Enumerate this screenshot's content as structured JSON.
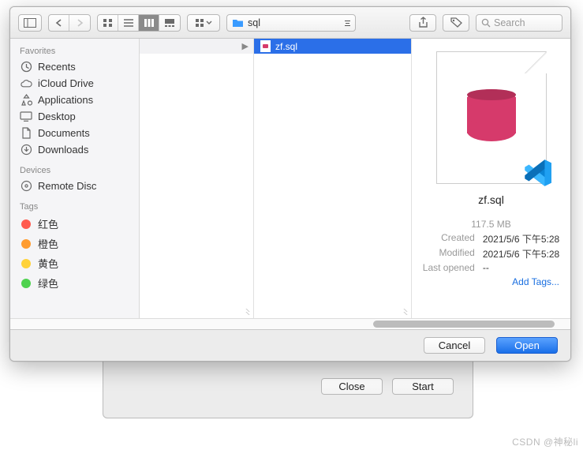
{
  "toolbar": {
    "path_label": "sql",
    "search_placeholder": "Search"
  },
  "sidebar": {
    "favorites_heading": "Favorites",
    "favorites": [
      {
        "icon": "clock",
        "label": "Recents"
      },
      {
        "icon": "cloud",
        "label": "iCloud Drive"
      },
      {
        "icon": "apps",
        "label": "Applications"
      },
      {
        "icon": "desktop",
        "label": "Desktop"
      },
      {
        "icon": "doc",
        "label": "Documents"
      },
      {
        "icon": "download",
        "label": "Downloads"
      }
    ],
    "devices_heading": "Devices",
    "devices": [
      {
        "icon": "disc",
        "label": "Remote Disc"
      }
    ],
    "tags_heading": "Tags",
    "tags": [
      {
        "color": "#ff5b4f",
        "label": "红色"
      },
      {
        "color": "#ff9c2f",
        "label": "橙色"
      },
      {
        "color": "#ffd23a",
        "label": "黄色"
      },
      {
        "color": "#4fd24f",
        "label": "绿色"
      }
    ]
  },
  "files": {
    "selected": {
      "name": "zf.sql"
    }
  },
  "preview": {
    "name": "zf.sql",
    "size": "117.5 MB",
    "created_label": "Created",
    "created_value": "2021/5/6 下午5:28",
    "modified_label": "Modified",
    "modified_value": "2021/5/6 下午5:28",
    "lastopened_label": "Last opened",
    "lastopened_value": "--",
    "add_tags": "Add Tags..."
  },
  "footer": {
    "cancel": "Cancel",
    "open": "Open"
  },
  "under_dialog": {
    "close": "Close",
    "start": "Start"
  },
  "watermark": "CSDN @神秘li"
}
